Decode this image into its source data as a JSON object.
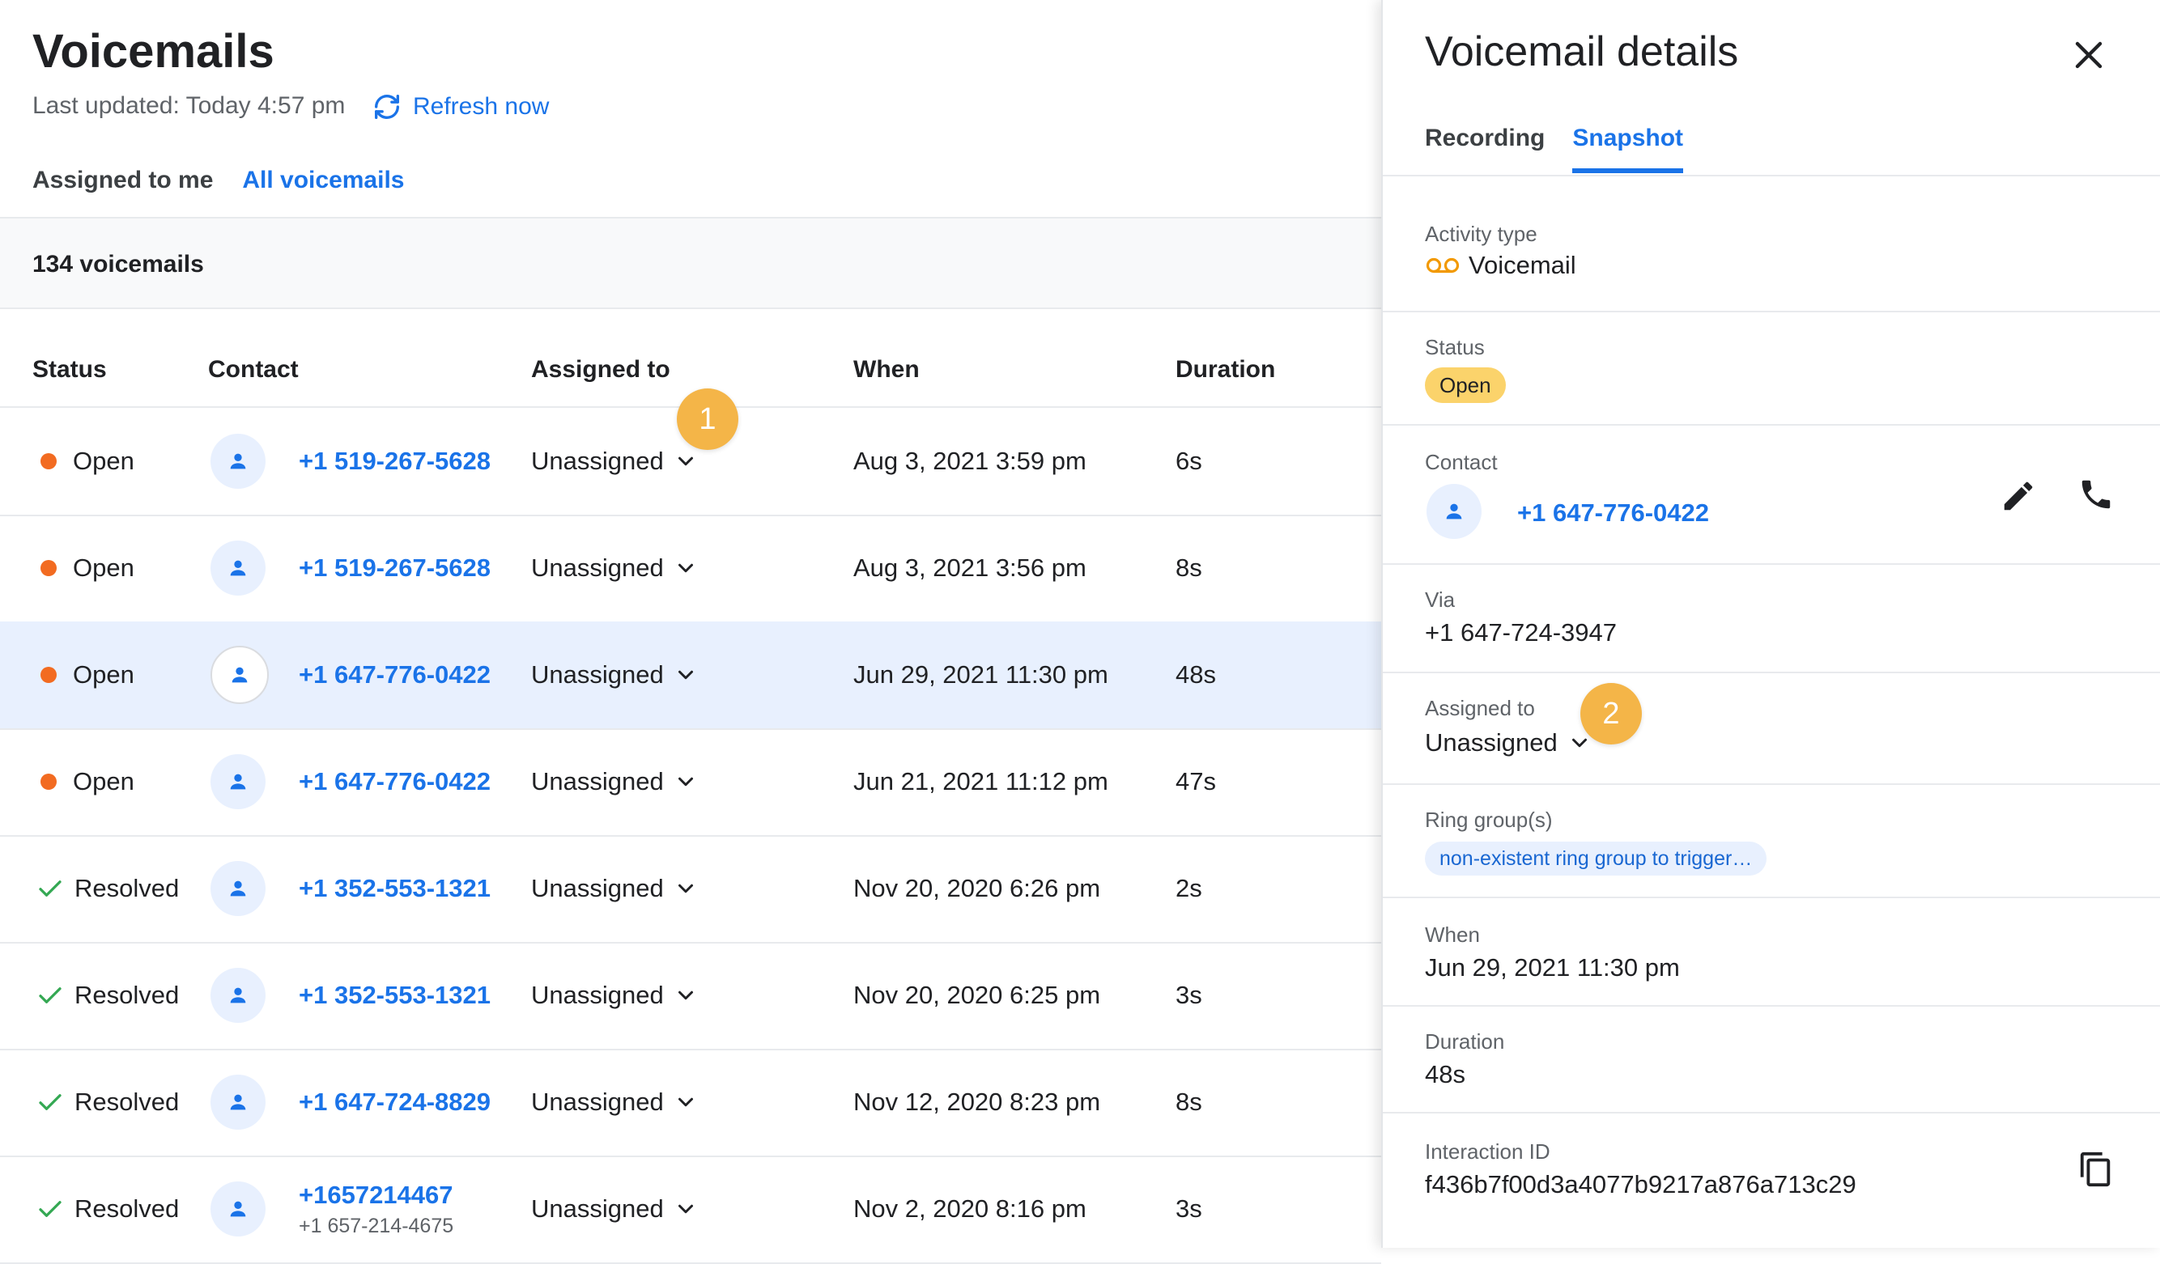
{
  "header": {
    "title": "Voicemails",
    "last_updated": "Last updated: Today 4:57 pm",
    "refresh_label": "Refresh now"
  },
  "tabs": [
    "Assigned to me",
    "All voicemails"
  ],
  "active_tab": "All voicemails",
  "count_label": "134 voicemails",
  "table": {
    "headers": [
      "Status",
      "Contact",
      "Assigned to",
      "When",
      "Duration"
    ],
    "rows": [
      {
        "status": "Open",
        "contact": "+1 519-267-5628",
        "assigned": "Unassigned",
        "when": "Aug 3, 2021 3:59 pm",
        "duration": "6s"
      },
      {
        "status": "Open",
        "contact": "+1 519-267-5628",
        "assigned": "Unassigned",
        "when": "Aug 3, 2021 3:56 pm",
        "duration": "8s"
      },
      {
        "status": "Open",
        "contact": "+1 647-776-0422",
        "assigned": "Unassigned",
        "when": "Jun 29, 2021 11:30 pm",
        "duration": "48s"
      },
      {
        "status": "Open",
        "contact": "+1 647-776-0422",
        "assigned": "Unassigned",
        "when": "Jun 21, 2021 11:12 pm",
        "duration": "47s"
      },
      {
        "status": "Resolved",
        "contact": "+1 352-553-1321",
        "assigned": "Unassigned",
        "when": "Nov 20, 2020 6:26 pm",
        "duration": "2s"
      },
      {
        "status": "Resolved",
        "contact": "+1 352-553-1321",
        "assigned": "Unassigned",
        "when": "Nov 20, 2020 6:25 pm",
        "duration": "3s"
      },
      {
        "status": "Resolved",
        "contact": "+1 647-724-8829",
        "assigned": "Unassigned",
        "when": "Nov 12, 2020 8:23 pm",
        "duration": "8s"
      },
      {
        "status": "Resolved",
        "contact": "+1657214467",
        "contact_sub": "+1 657-214-4675",
        "assigned": "Unassigned",
        "when": "Nov 2, 2020 8:16 pm",
        "duration": "3s"
      }
    ]
  },
  "callouts": [
    "1",
    "2"
  ],
  "details": {
    "title": "Voicemail details",
    "tabs": [
      "Recording",
      "Snapshot"
    ],
    "active_tab": "Snapshot",
    "activity_type_label": "Activity type",
    "activity_type": "Voicemail",
    "status_label": "Status",
    "status": "Open",
    "contact_label": "Contact",
    "contact": "+1 647-776-0422",
    "via_label": "Via",
    "via": "+1 647-724-3947",
    "assigned_label": "Assigned to",
    "assigned": "Unassigned",
    "ring_groups_label": "Ring group(s)",
    "ring_group": "non-existent ring group to trigger…",
    "when_label": "When",
    "when": "Jun 29, 2021 11:30 pm",
    "duration_label": "Duration",
    "duration": "48s",
    "interaction_id_label": "Interaction ID",
    "interaction_id": "f436b7f00d3a4077b9217a876a713c29"
  },
  "icons": {
    "refresh": "refresh-icon",
    "avatar": "person-icon",
    "open_status": "orange-dot-icon",
    "resolved_status": "check-icon",
    "dropdown": "chevron-down-icon",
    "close": "close-icon",
    "voicemail": "voicemail-icon",
    "edit": "pencil-icon",
    "call": "phone-icon",
    "copy": "copy-icon"
  },
  "colors": {
    "accent": "#1a73e8",
    "open_dot": "#f26b21",
    "resolved_check": "#34a853",
    "selected_row": "#e8f0fe",
    "badge": "#f4b548",
    "status_pill": "#fbd36b"
  }
}
